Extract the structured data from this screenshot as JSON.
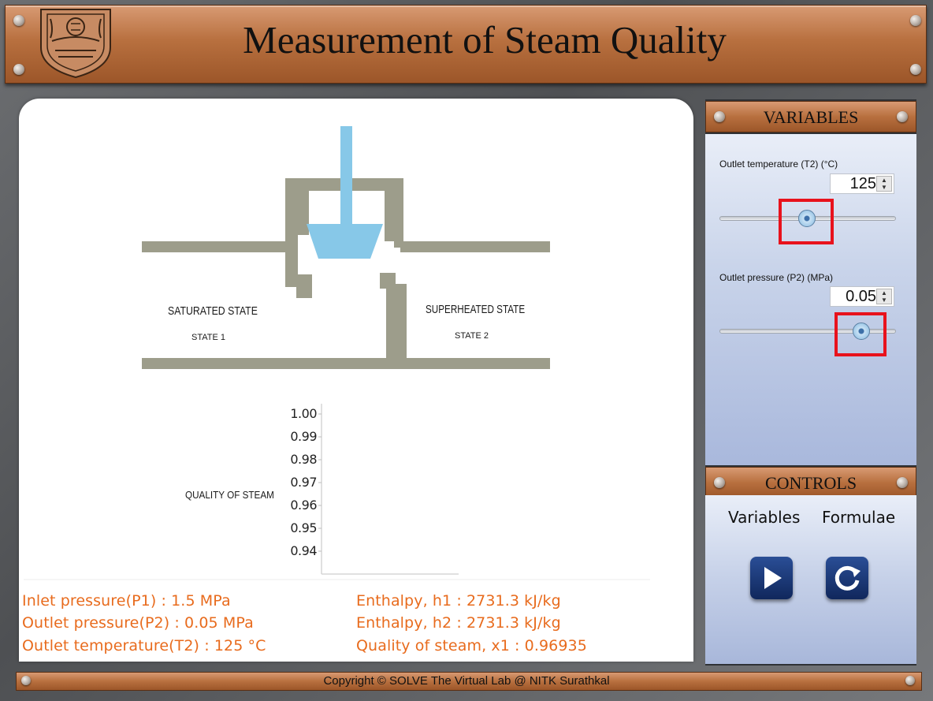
{
  "header": {
    "title": "Measurement of Steam Quality"
  },
  "diagram": {
    "state1_label": "SATURATED STATE",
    "state1_sub": "STATE 1",
    "state2_label": "SUPERHEATED STATE",
    "state2_sub": "STATE 2",
    "quality_label": "QUALITY OF STEAM",
    "yticks": [
      "1.00",
      "0.99",
      "0.98",
      "0.97",
      "0.96",
      "0.95",
      "0.94"
    ]
  },
  "results": {
    "inlet_pressure": "Inlet pressure(P1) : 1.5 MPa",
    "outlet_pressure": "Outlet pressure(P2) : 0.05 MPa",
    "outlet_temperature": "Outlet temperature(T2) : 125 °C",
    "enthalpy_h1": "Enthalpy, h1 : 2731.3 kJ/kg",
    "enthalpy_h2": "Enthalpy, h2 : 2731.3 kJ/kg",
    "quality_x1": "Quality of steam, x1 : 0.96935"
  },
  "variables": {
    "title": "VARIABLES",
    "t2": {
      "label": "Outlet temperature (T2) (°C)",
      "value": "125",
      "fraction": 0.49
    },
    "p2": {
      "label": "Outlet pressure (P2) (MPa)",
      "value": "0.05",
      "fraction": 0.8
    }
  },
  "controls": {
    "title": "CONTROLS",
    "variables_label": "Variables",
    "formulae_label": "Formulae",
    "play_icon": "play-icon",
    "reset_icon": "reset-icon"
  },
  "footer": {
    "copyright": "Copyright © SOLVE The Virtual Lab @ NITK Surathkal"
  },
  "colors": {
    "copper": "#b8703f",
    "pipe": "#9d9d8b",
    "water": "#87c8e8",
    "result_text": "#e86b1d",
    "highlight": "#e8121c"
  }
}
